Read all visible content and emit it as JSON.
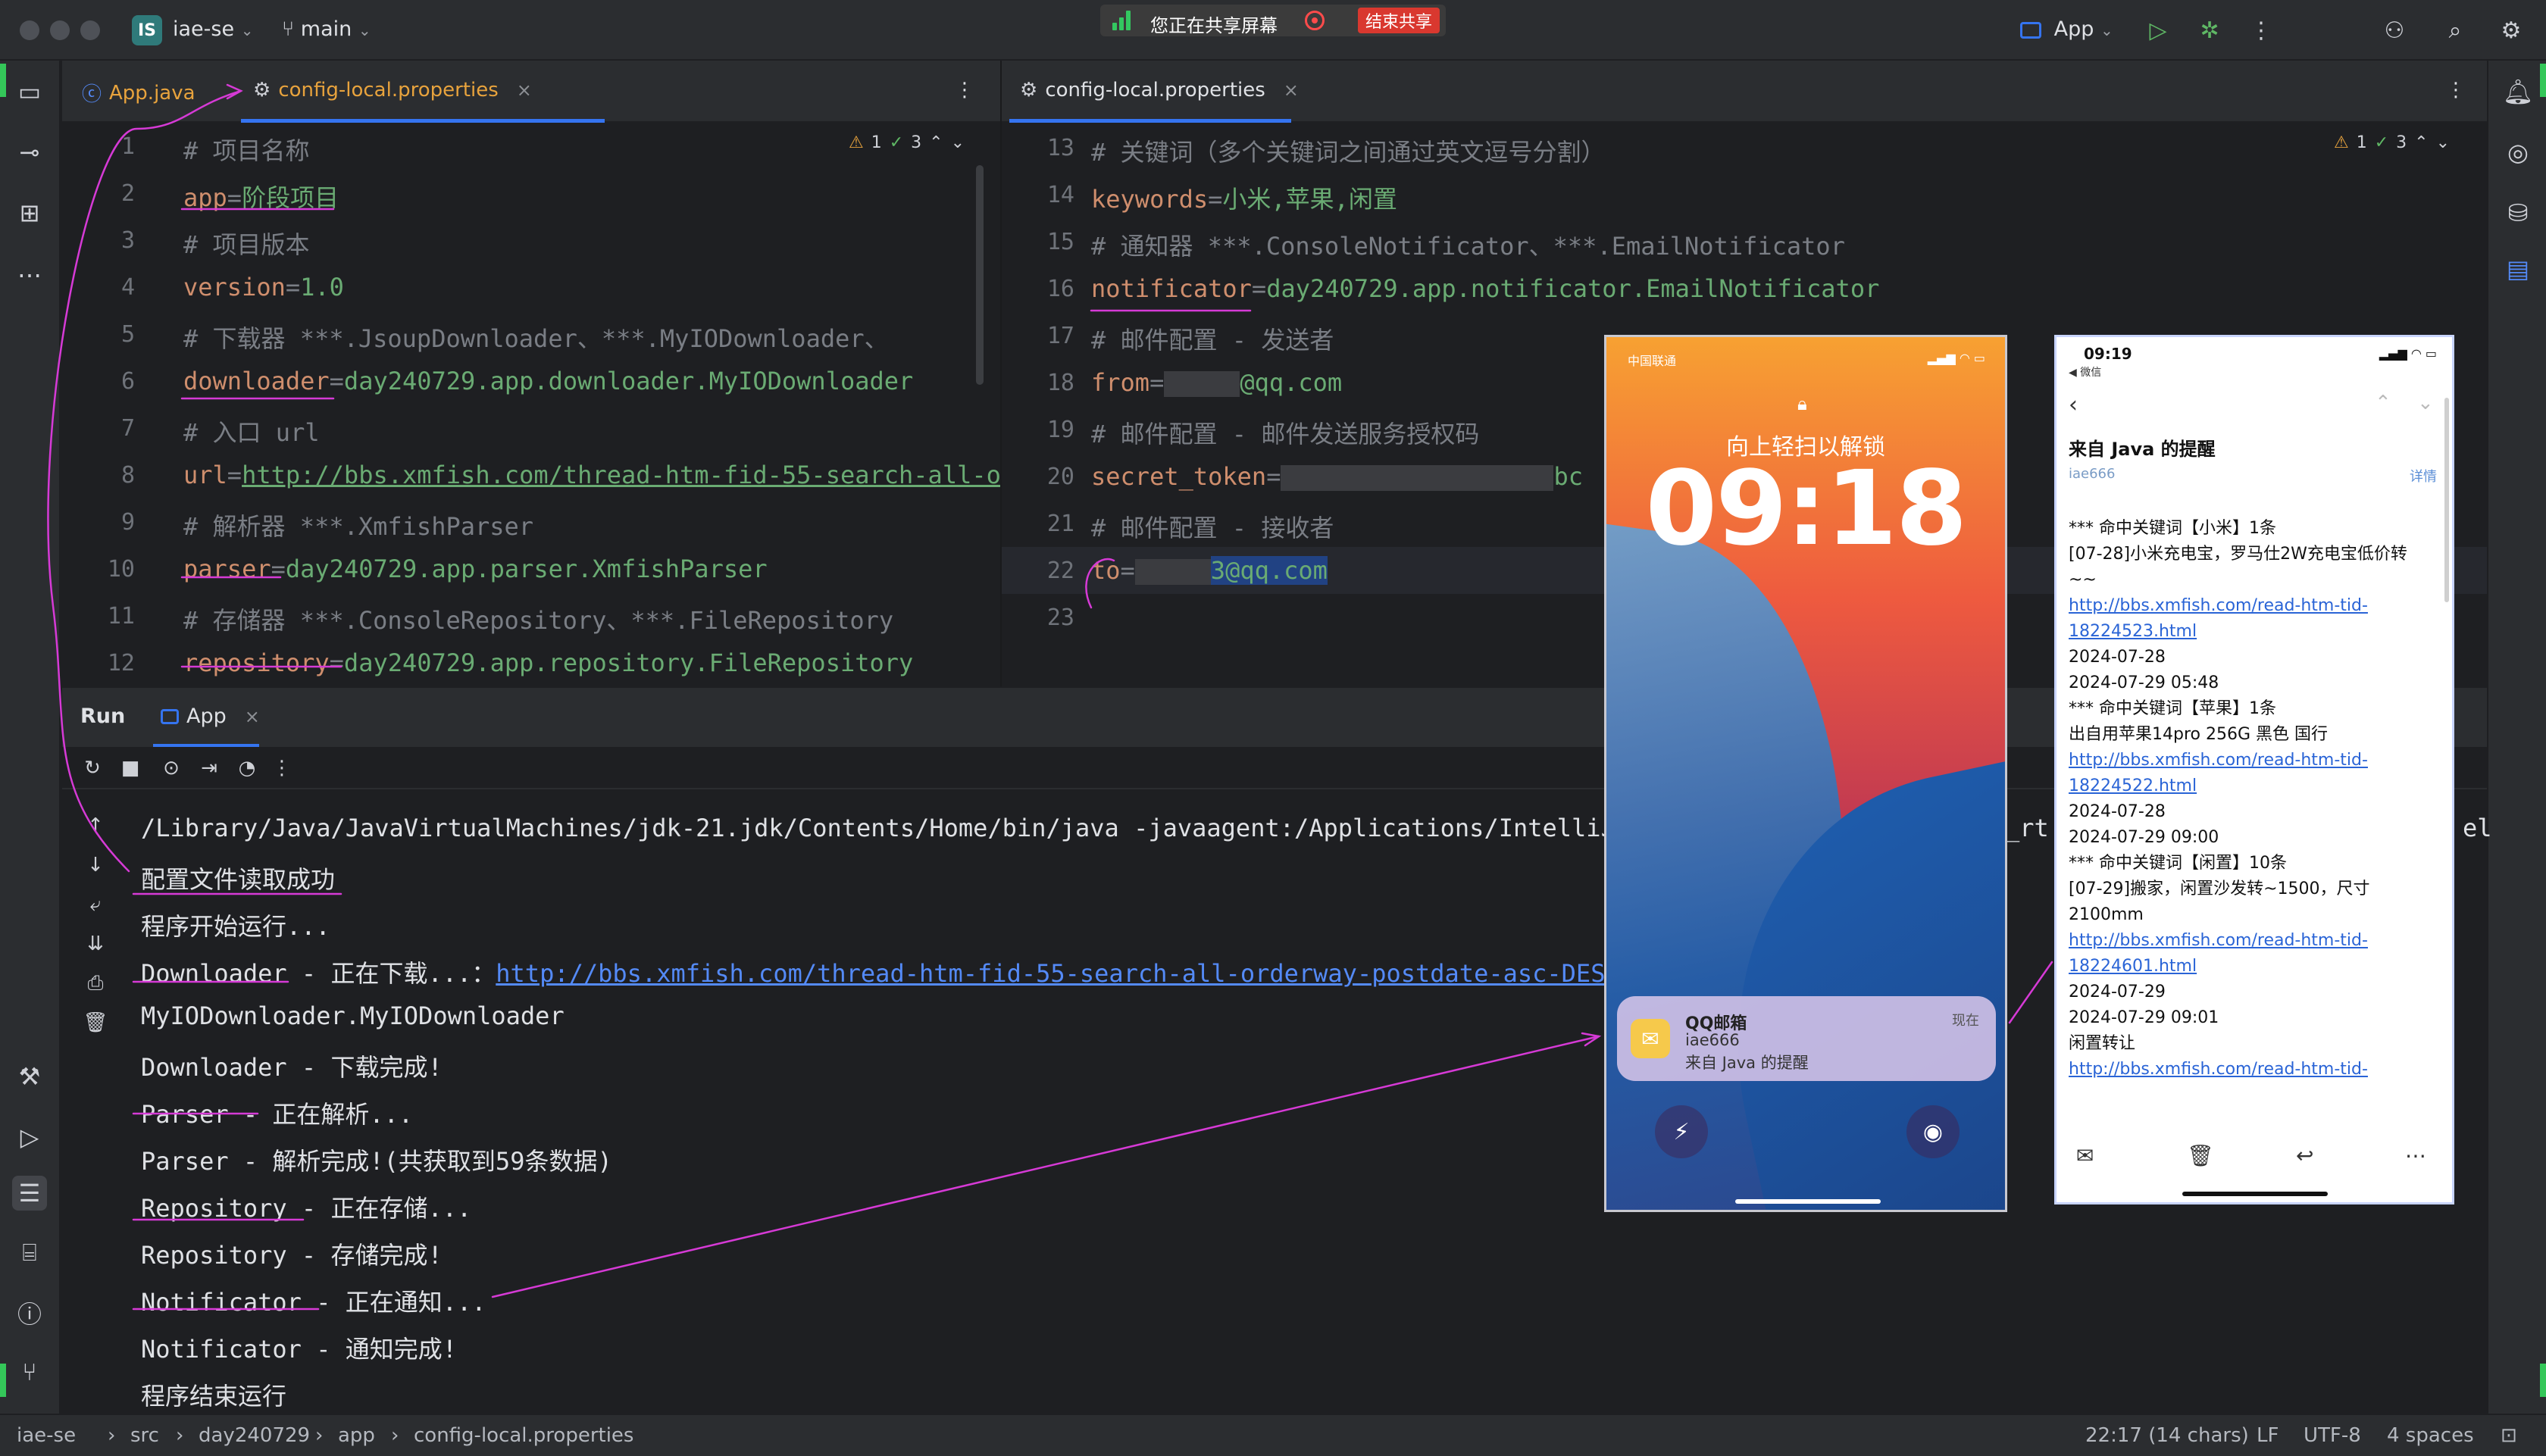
{
  "titlebar": {
    "project_badge": "IS",
    "project_name": "iae-se",
    "branch": "main",
    "run_config": "App",
    "icons": [
      "branch-icon",
      "run-icon",
      "debug-icon",
      "more-icon",
      "add-user-icon",
      "search-icon",
      "settings-icon"
    ]
  },
  "sharing": {
    "status": "您正在共享屏幕",
    "stop_label": "结束共享",
    "colors": {
      "banner": "#3b3b3b",
      "stop": "#d9382f",
      "indicator": "#33c760"
    }
  },
  "left_editor": {
    "tabs": [
      {
        "label": "App.java",
        "icon": "java-class-icon"
      },
      {
        "label": "config-local.properties",
        "icon": "gear-icon",
        "active": true
      }
    ],
    "inspection": {
      "warnings": "1",
      "checks": "3"
    },
    "lines": [
      {
        "n": "1",
        "kind": "comment",
        "text": "# 项目名称"
      },
      {
        "n": "2",
        "kind": "kv",
        "key": "app",
        "value": "阶段项目"
      },
      {
        "n": "3",
        "kind": "comment",
        "text": "# 项目版本"
      },
      {
        "n": "4",
        "kind": "kv",
        "key": "version",
        "value": "1.0"
      },
      {
        "n": "5",
        "kind": "comment",
        "text": "# 下载器 ***.JsoupDownloader、***.MyIODownloader、"
      },
      {
        "n": "6",
        "kind": "kv",
        "key": "downloader",
        "value": "day240729.app.downloader.MyIODownloader"
      },
      {
        "n": "7",
        "kind": "comment",
        "text": "# 入口 url"
      },
      {
        "n": "8",
        "kind": "kv",
        "key": "url",
        "value": "http://bbs.xmfish.com/thread-htm-fid-55-search-all-o"
      },
      {
        "n": "9",
        "kind": "comment",
        "text": "# 解析器 ***.XmfishParser"
      },
      {
        "n": "10",
        "kind": "kv",
        "key": "parser",
        "value": "day240729.app.parser.XmfishParser"
      },
      {
        "n": "11",
        "kind": "comment",
        "text": "# 存储器 ***.ConsoleRepository、***.FileRepository"
      },
      {
        "n": "12",
        "kind": "kv",
        "key": "repository",
        "value": "day240729.app.repository.FileRepository"
      }
    ]
  },
  "right_editor": {
    "tab": {
      "label": "config-local.properties",
      "icon": "gear-icon"
    },
    "inspection": {
      "warnings": "1",
      "checks": "3"
    },
    "lines": [
      {
        "n": "13",
        "kind": "comment",
        "text": "# 关键词（多个关键词之间通过英文逗号分割）"
      },
      {
        "n": "14",
        "kind": "kv",
        "key": "keywords",
        "value": "小米,苹果,闲置"
      },
      {
        "n": "15",
        "kind": "comment",
        "text": "# 通知器 ***.ConsoleNotificator、***.EmailNotificator"
      },
      {
        "n": "16",
        "kind": "kv",
        "key": "notificator",
        "value": "day240729.app.notificator.EmailNotificator"
      },
      {
        "n": "17",
        "kind": "comment",
        "text": "# 邮件配置 - 发送者"
      },
      {
        "n": "18",
        "kind": "kv",
        "key": "from",
        "value": "@qq.com"
      },
      {
        "n": "19",
        "kind": "comment",
        "text": "# 邮件配置 - 邮件发送服务授权码"
      },
      {
        "n": "20",
        "kind": "kv",
        "key": "secret_token",
        "value": "bc"
      },
      {
        "n": "21",
        "kind": "comment",
        "text": "# 邮件配置 - 接收者"
      },
      {
        "n": "22",
        "kind": "kv",
        "key": "to",
        "value": "3@qq.com"
      },
      {
        "n": "23",
        "kind": "empty",
        "text": ""
      }
    ]
  },
  "run": {
    "title": "Run",
    "tab": "App",
    "output": [
      {
        "text": "/Library/Java/JavaVirtualMachines/jdk-21.jdk/Contents/Home/bin/java -javaagent:/Applications/IntelliJ"
      },
      {
        "text": "配置文件读取成功"
      },
      {
        "text": "程序开始运行..."
      },
      {
        "text": "Downloader - 正在下载...：",
        "link": "http://bbs.xmfish.com/thread-htm-fid-55-search-all-orderway-postdate-asc-DES"
      },
      {
        "text": "MyIODownloader.MyIODownloader"
      },
      {
        "text": "Downloader - 下载完成!"
      },
      {
        "text": "Parser - 正在解析..."
      },
      {
        "text": "Parser - 解析完成!(共获取到59条数据)"
      },
      {
        "text": "Repository - 正在存储..."
      },
      {
        "text": "Repository - 存储完成!"
      },
      {
        "text": "Notificator - 正在通知..."
      },
      {
        "text": "Notificator - 通知完成!"
      },
      {
        "text": "程序结束运行"
      }
    ],
    "overflow_fragment_1": "_rt.",
    "overflow_fragment_2": "el"
  },
  "lockscreen": {
    "carrier": "中国联通",
    "hint": "向上轻扫以解锁",
    "time": "09:18",
    "notification": {
      "app": "QQ邮箱",
      "sender": "iae666",
      "title": "来自 Java 的提醒",
      "when": "现在"
    }
  },
  "mail": {
    "status_time": "09:19",
    "back_app": "◀ 微信",
    "subject": "来自 Java 的提醒",
    "from": "iae666",
    "detail_label": "详情",
    "body": [
      {
        "t": "*** 命中关键词【小米】1条"
      },
      {
        "t": "[07-28]小米充电宝，罗马仕2W充电宝低价转"
      },
      {
        "t": "~~"
      },
      {
        "t": "http://bbs.xmfish.com/read-htm-tid-",
        "link": true
      },
      {
        "t": "18224523.html",
        "link": true
      },
      {
        "t": "2024-07-28"
      },
      {
        "t": "2024-07-29 05:48"
      },
      {
        "t": "*** 命中关键词【苹果】1条"
      },
      {
        "t": "出自用苹果14pro 256G 黑色 国行"
      },
      {
        "t": "http://bbs.xmfish.com/read-htm-tid-",
        "link": true
      },
      {
        "t": "18224522.html",
        "link": true
      },
      {
        "t": "2024-07-28"
      },
      {
        "t": "2024-07-29 09:00"
      },
      {
        "t": "*** 命中关键词【闲置】10条"
      },
      {
        "t": "[07-29]搬家，闲置沙发转~1500，尺寸"
      },
      {
        "t": "2100mm"
      },
      {
        "t": "http://bbs.xmfish.com/read-htm-tid-",
        "link": true
      },
      {
        "t": "18224601.html",
        "link": true
      },
      {
        "t": "2024-07-29"
      },
      {
        "t": "2024-07-29 09:01"
      },
      {
        "t": "闲置转让"
      },
      {
        "t": "http://bbs.xmfish.com/read-htm-tid-",
        "link": true
      }
    ]
  },
  "statusbar": {
    "crumbs": [
      "iae-se",
      "src",
      "day240729",
      "app",
      "config-local.properties"
    ],
    "position": "22:17 (14 chars)",
    "line_sep": "LF",
    "encoding": "UTF-8",
    "indent": "4 spaces"
  },
  "colors": {
    "editor_bg": "#1e1f22",
    "chrome_bg": "#2b2d30",
    "comment": "#7a7e85",
    "key": "#cf8e6d",
    "value": "#6aab73",
    "link": "#548af7",
    "annotation": "#d63ad6",
    "accent": "#3574f0"
  }
}
